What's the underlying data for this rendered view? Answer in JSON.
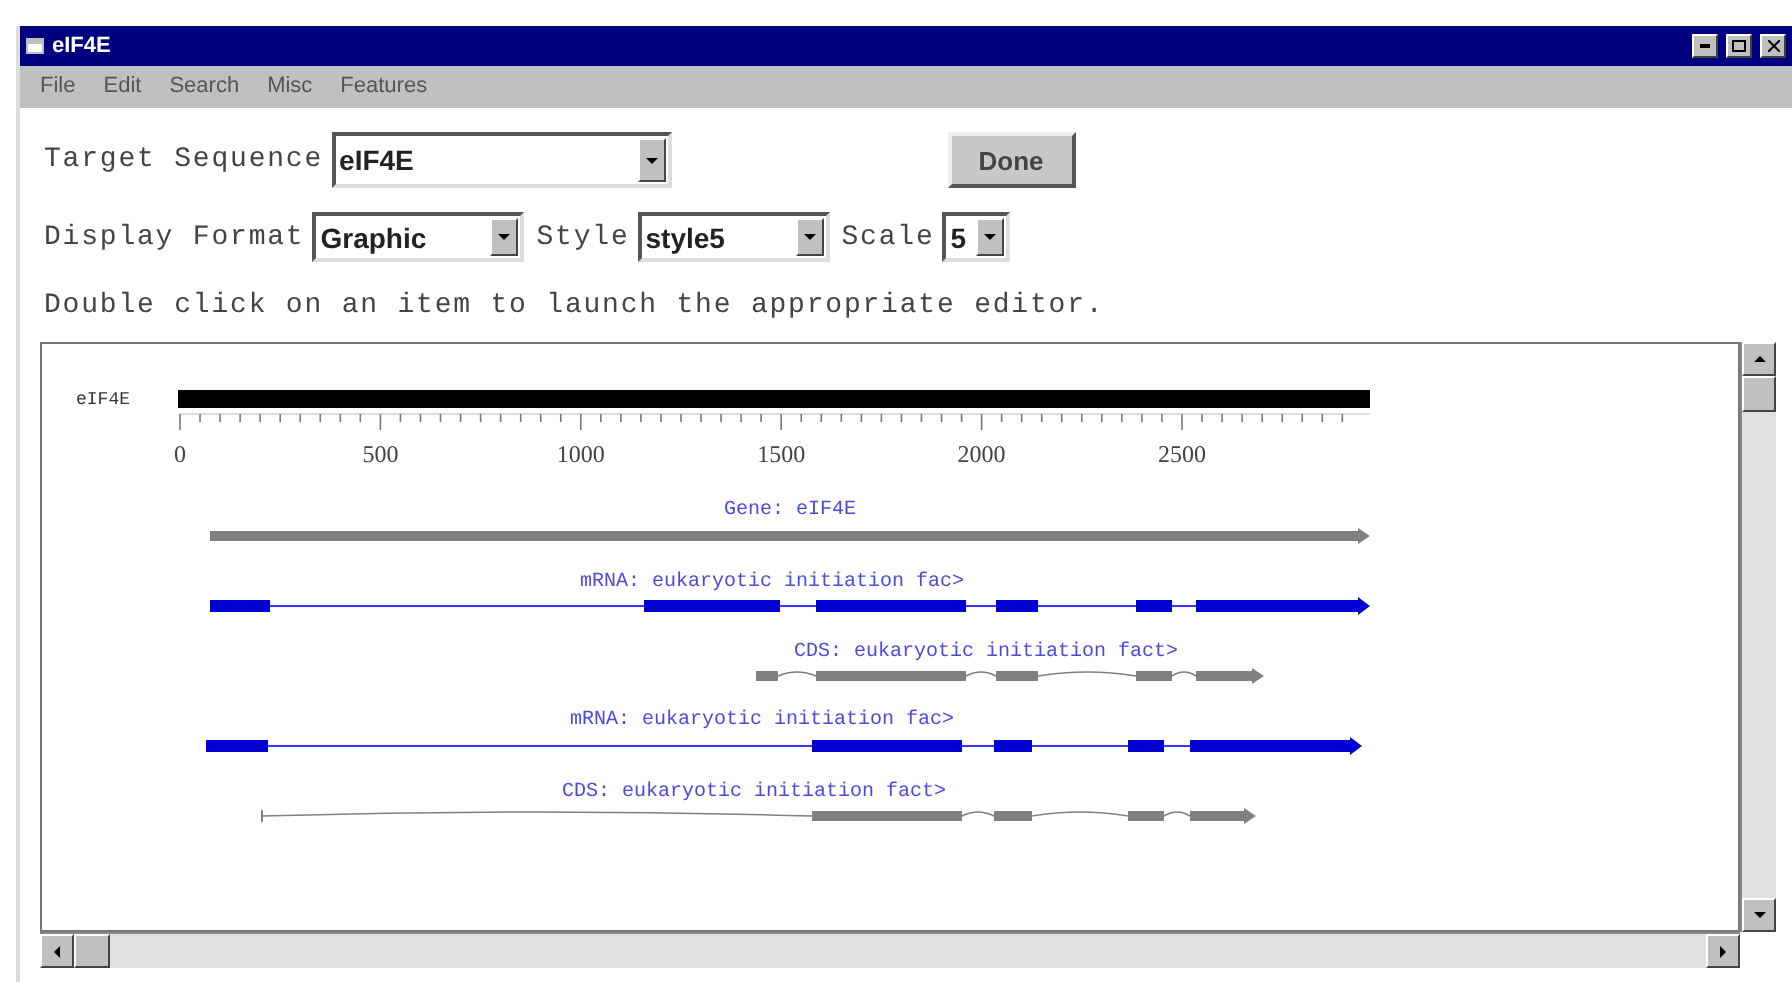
{
  "window": {
    "title": "eIF4E"
  },
  "menu": [
    "File",
    "Edit",
    "Search",
    "Misc",
    "Features"
  ],
  "target": {
    "label": "Target Sequence",
    "value": "eIF4E"
  },
  "done_button": "Done",
  "format": {
    "label": "Display Format",
    "value": "Graphic"
  },
  "style": {
    "label": "Style",
    "value": "style5"
  },
  "scale": {
    "label": "Scale",
    "value": "5"
  },
  "hint": "Double click on an item to launch the appropriate editor.",
  "map": {
    "sequence": "eIF4E",
    "ticks": [
      "0",
      "500",
      "1000",
      "1500",
      "2000",
      "2500"
    ],
    "features": [
      {
        "kind": "gene",
        "label": "Gene: eIF4E"
      },
      {
        "kind": "mrna",
        "label": "mRNA: eukaryotic initiation fac>"
      },
      {
        "kind": "cds",
        "label": "CDS: eukaryotic initiation fact>"
      },
      {
        "kind": "mrna",
        "label": "mRNA: eukaryotic initiation fac>"
      },
      {
        "kind": "cds",
        "label": "CDS: eukaryotic initiation fact>"
      }
    ]
  }
}
